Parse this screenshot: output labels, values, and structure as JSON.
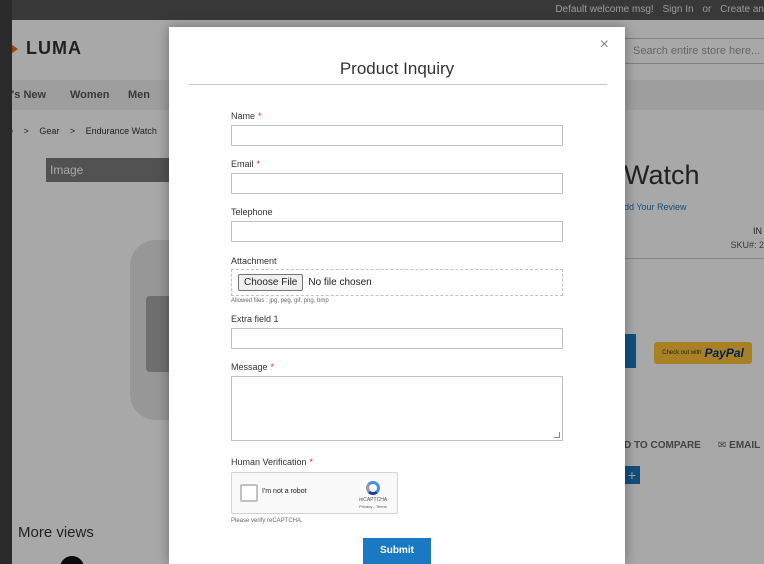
{
  "store": {
    "welcome": {
      "message": "Default welcome msg!",
      "sign_in": "Sign In",
      "or": "or",
      "create": "Create an"
    },
    "logo": {
      "text": "LUMA",
      "color": "#f26322"
    },
    "search": {
      "placeholder": "Search entire store here..."
    },
    "nav": {
      "items": [
        "t's New",
        "Women",
        "Men"
      ]
    },
    "breadcrumb": [
      "e",
      ">",
      "Gear",
      ">",
      "Endurance Watch"
    ],
    "gallery": {
      "label": "Image",
      "more_views": "More views"
    },
    "product": {
      "title_fragment": "Watch",
      "review_link": "dd Your Review",
      "stock_fragment": "IN",
      "sku_fragment": "SKU#: 2",
      "paypal_small": "Check out with",
      "paypal_brand": "PayPal",
      "compare_fragment": "D TO COMPARE",
      "email_label": "✉ EMAIL",
      "plus": "+"
    }
  },
  "modal": {
    "title": "Product Inquiry",
    "close_symbol": "×",
    "accent_color": "#1979c3",
    "required_mark": "*",
    "fields": {
      "name": {
        "label": "Name",
        "required": true,
        "value": ""
      },
      "email": {
        "label": "Email",
        "required": true,
        "value": ""
      },
      "telephone": {
        "label": "Telephone",
        "required": false,
        "value": ""
      },
      "attachment": {
        "label": "Attachment",
        "button": "Choose File",
        "status": "No file chosen",
        "hint": "Allowed files : jpg, peg, gif, png, bmp"
      },
      "extra": {
        "label": "Extra field 1",
        "value": ""
      },
      "message": {
        "label": "Message",
        "required": true,
        "value": ""
      },
      "verification": {
        "label": "Human Verification",
        "required": true,
        "captcha_text": "I'm not a robot",
        "captcha_brand": "reCAPTCHA",
        "captcha_links": "Privacy - Terms",
        "note": "Please verify reCAPTCHA."
      }
    },
    "submit_label": "Submit"
  }
}
